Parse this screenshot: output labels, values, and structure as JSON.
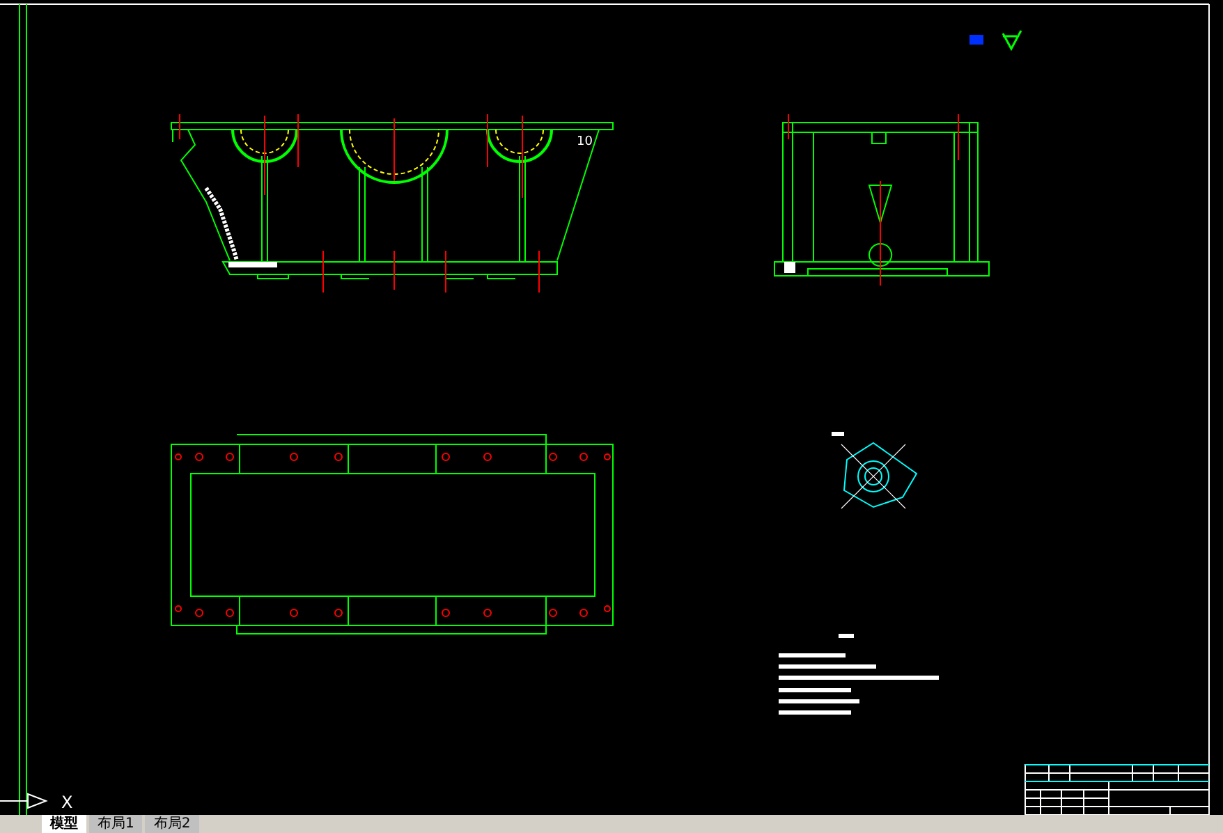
{
  "drawing": {
    "dimension_label": "10",
    "ucs_axis_label": "X"
  },
  "layout_tabs": [
    {
      "label": "模型",
      "selected": true
    },
    {
      "label": "布局1",
      "selected": false
    },
    {
      "label": "布局2",
      "selected": false
    }
  ]
}
